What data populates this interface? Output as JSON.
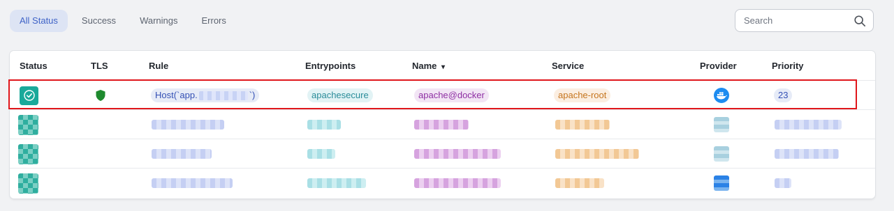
{
  "filters": {
    "tabs": [
      {
        "label": "All Status",
        "active": true
      },
      {
        "label": "Success",
        "active": false
      },
      {
        "label": "Warnings",
        "active": false
      },
      {
        "label": "Errors",
        "active": false
      }
    ]
  },
  "search": {
    "placeholder": "Search",
    "icon": "search-icon"
  },
  "table": {
    "columns": [
      "Status",
      "TLS",
      "Rule",
      "Entrypoints",
      "Name",
      "Service",
      "Provider",
      "Priority"
    ],
    "sort_indicator": "▾",
    "rows": [
      {
        "status": "success",
        "tls": true,
        "rule_prefix": "Host(`app.",
        "rule_suffix": "`)",
        "entrypoints": "apachesecure",
        "name": "apache@docker",
        "service": "apache-root",
        "provider": "docker",
        "priority": "23"
      }
    ]
  },
  "colors": {
    "accent": "#3f63c7",
    "success": "#1aa99a",
    "tls_shield": "#1e8a2e",
    "docker": "#1d8cf0",
    "highlight_box": "#e0161b"
  }
}
